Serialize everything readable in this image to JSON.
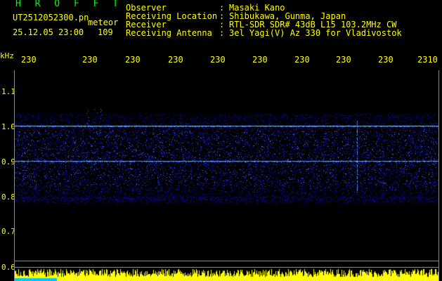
{
  "header": {
    "brand": "H R O F F T",
    "filename": "UT2512052300.pn",
    "meteor_label": "meteor",
    "datetime": "25.12.05 23:00",
    "meteor_count": "109",
    "info_labels": "Observer\nReceiving Location\nReceiver\nReceiving Antenna",
    "info_seps": ":\n:\n:\n:",
    "info_values": "Masaki Kano\nShibukawa, Gunma, Japan\nRTL-SDR SDR# 43dB L15 103.2MHz CW\n3el Yagi(V) Az 330 for Vladivostok"
  },
  "time_axis": {
    "labels": [
      "230",
      "230",
      "230",
      "230",
      "230",
      "230",
      "230",
      "230",
      "230",
      "2310"
    ]
  },
  "freq_axis": {
    "unit": "kHz",
    "labels": [
      "1.1",
      "1.0",
      "0.9",
      "0.8",
      "0.7",
      "0.6"
    ]
  },
  "colors": {
    "background": "#000000",
    "text_green": "#00ff00",
    "text_yellow": "#ffff00",
    "signal_low": "#0000a0",
    "signal_mid": "#2040ff",
    "signal_high": "#40ffc0",
    "level_bar": "#ffff00",
    "level_base": "#00c0ff"
  }
}
